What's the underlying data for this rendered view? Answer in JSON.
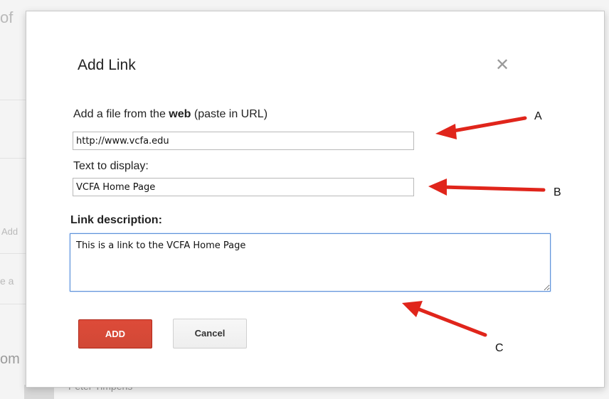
{
  "background": {
    "fragment_top": "of",
    "fragment_add": "Add",
    "fragment_e": "e a",
    "fragment_om": "om",
    "fragment_name": "Peter Timpens"
  },
  "dialog": {
    "title": "Add Link",
    "close_icon": "close-icon",
    "url_label_prefix": "Add a file from the ",
    "url_label_bold": "web",
    "url_label_suffix": " (paste in URL)",
    "url_value": "http://www.vcfa.edu",
    "text_label": "Text to display:",
    "text_value": "VCFA Home Page",
    "description_label": "Link description:",
    "description_value": "This is a link to the VCFA Home Page",
    "add_button": "ADD",
    "cancel_button": "Cancel"
  },
  "annotations": {
    "a": "A",
    "b": "B",
    "c": "C",
    "arrow_color": "#e0251b"
  }
}
